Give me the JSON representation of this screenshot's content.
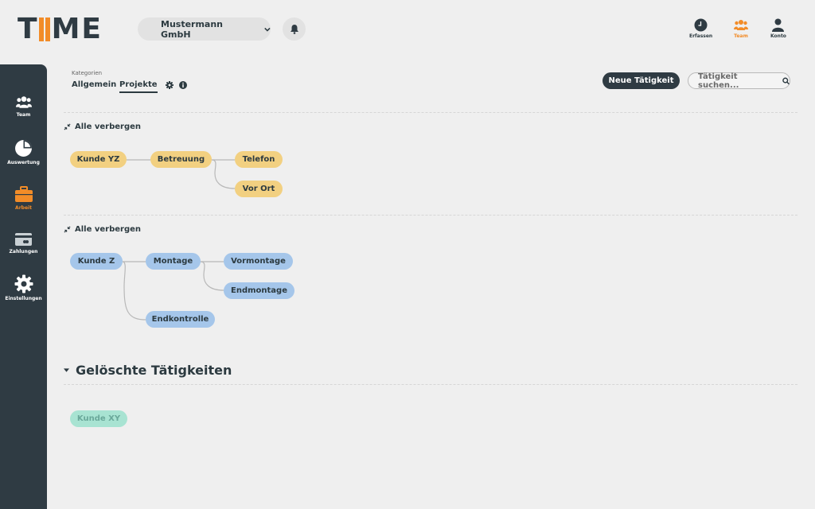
{
  "header": {
    "logo": [
      "T",
      "I",
      "I",
      "M",
      "E"
    ],
    "company": "Mustermann GmbH",
    "nav": [
      {
        "label": "Erfassen",
        "icon": "clock-icon"
      },
      {
        "label": "Team",
        "icon": "team-icon"
      },
      {
        "label": "Konto",
        "icon": "user-icon"
      }
    ]
  },
  "sidebar": {
    "items": [
      {
        "label": "Team",
        "icon": "team-icon"
      },
      {
        "label": "Auswertung",
        "icon": "pie-chart-icon"
      },
      {
        "label": "Arbeit",
        "icon": "briefcase-icon"
      },
      {
        "label": "Zahlungen",
        "icon": "payment-card-icon"
      },
      {
        "label": "Einstellungen",
        "icon": "gear-icon"
      }
    ]
  },
  "categories": {
    "label": "Kategorien",
    "tabs": [
      "Allgemein",
      "Projekte"
    ],
    "active_tab": "Projekte"
  },
  "actions": {
    "new_button": "Neue Tätigkeit",
    "search_placeholder": "Tätigkeit suchen..."
  },
  "groups": [
    {
      "hide_label": "Alle verbergen",
      "nodes": [
        "Kunde YZ",
        "Betreuung",
        "Telefon",
        "Vor Ort"
      ]
    },
    {
      "hide_label": "Alle verbergen",
      "nodes": [
        "Kunde Z",
        "Montage",
        "Vormontage",
        "Endmontage",
        "Endkontrolle"
      ]
    }
  ],
  "deleted": {
    "title": "Gelöschte Tätigkeiten",
    "nodes": [
      "Kunde XY"
    ]
  },
  "colors": {
    "dark": "#2f3b43",
    "accent": "#f28c28",
    "yellow_node": "#f2d081",
    "blue_node": "#a5c6ea",
    "green_node": "#a8e3d2"
  }
}
